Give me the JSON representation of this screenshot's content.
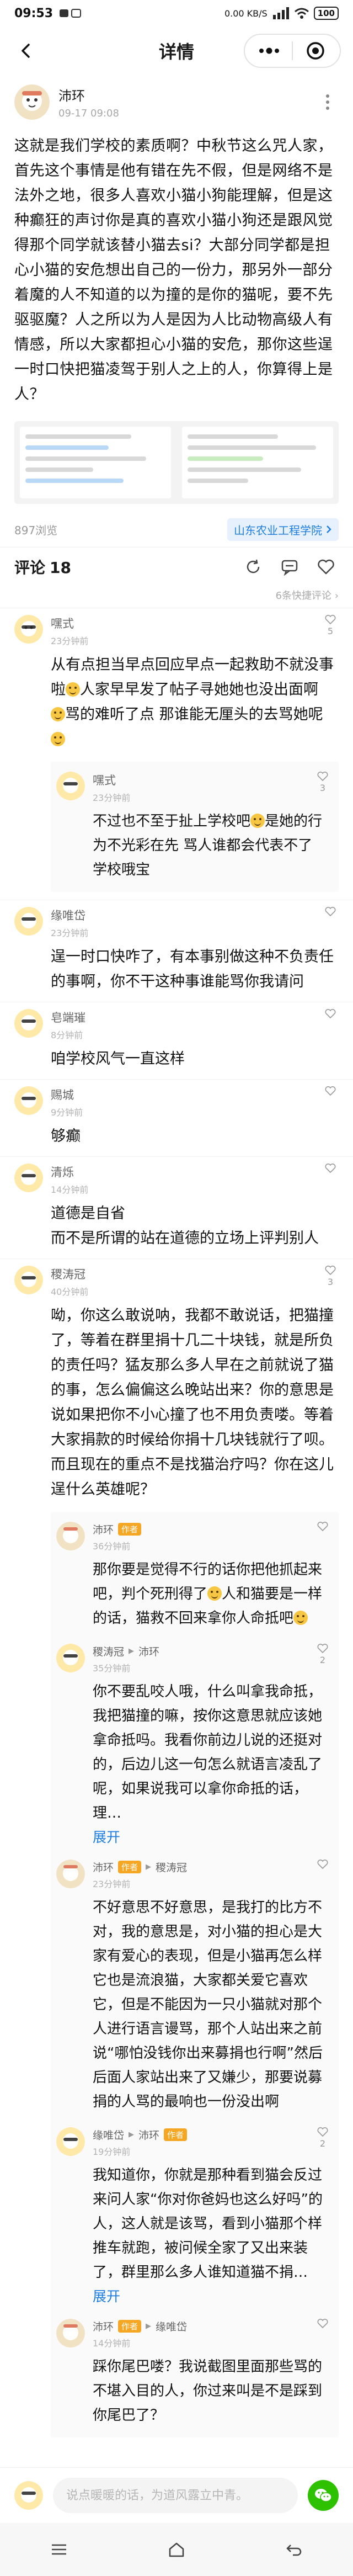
{
  "status": {
    "time": "09:53",
    "indicators": "0.00 KB/S",
    "battery": "100"
  },
  "nav": {
    "title": "详情"
  },
  "post": {
    "author": "沛环",
    "time": "09-17 09:08",
    "body": "这就是我们学校的素质啊？中秋节这么咒人家，首先这个事情是他有错在先不假，但是网络不是法外之地，很多人喜欢小猫小狗能理解，但是这种癫狂的声讨你是真的喜欢小猫小狗还是跟风觉得那个同学就该替小猫去si？大部分同学都是担心小猫的安危想出自己的一份力，那另外一部分着魔的人不知道的以为撞的是你的猫呢，要不先驱驱魔？人之所以为人是因为人比动物高级人有情感，所以大家都担心小猫的安危，那你这些逞一时口快把猫凌驾于别人之上的人，你算得上是人？",
    "views": "897浏览",
    "tag": "山东农业工程学院"
  },
  "comments_header": {
    "title": "评论",
    "count": "18",
    "hidden_note": "6条快捷评论"
  },
  "comments": [
    {
      "name": "嘿式",
      "time": "23分钟前",
      "likes": "5",
      "text_a": "从有点担当早点回应早点一起救助不就没事啦",
      "text_b": "人家早早发了帖子寻她她也没出面啊",
      "text_c": "骂的难听了点 那谁能无厘头的去骂她呢",
      "reply": {
        "name": "嘿式",
        "time": "23分钟前",
        "likes": "3",
        "text": "不过也不至于扯上学校吧",
        "text_b": "是她的行为不光彩在先 骂人谁都会代表不了学校哦宝"
      }
    },
    {
      "name": "缘唯岱",
      "time": "23分钟前",
      "likes": "",
      "text": "逞一时口快咋了，有本事别做这种不负责任的事啊，你不干这种事谁能骂你我请问"
    },
    {
      "name": "皂端璀",
      "time": "8分钟前",
      "likes": "",
      "text": "咱学校风气一直这样"
    },
    {
      "name": "赐城",
      "time": "9分钟前",
      "likes": "",
      "text": "够癫"
    },
    {
      "name": "清烁",
      "time": "14分钟前",
      "likes": "",
      "text": "道德是自省\n而不是所谓的站在道德的立场上评判别人"
    },
    {
      "name": "稷涛冠",
      "time": "40分钟前",
      "likes": "3",
      "text": "呦，你这么敢说呐，我都不敢说话，把猫撞了，等着在群里捐十几二十块钱，就是所负的责任吗？猛友那么多人早在之前就说了猫的事，怎么偏偏这么晚站出来？你的意思是说如果把你不小心撞了也不用负责喽。等着大家捐款的时候给你捐十几块钱就行了呗。而且现在的重点不是找猫治疗吗？你在这儿逞什么英雄呢？",
      "replies": [
        {
          "name": "沛环",
          "badge": "作者",
          "target": "",
          "time": "36分钟前",
          "likes": "",
          "text_a": "那你要是觉得不行的话你把他抓起来吧，判个死刑得了",
          "text_b": "人和猫要是一样的话，猫救不回来拿你人命抵吧",
          "expand": ""
        },
        {
          "name": "稷涛冠",
          "badge": "",
          "target": "沛环",
          "time": "35分钟前",
          "likes": "2",
          "text_a": "你不要乱咬人哦，什么叫拿我命抵，我把猫撞的嘛，按你这意思就应该她拿命抵吗。我看你前边儿说的还挺对的，后边儿这一句怎么就语言凌乱了呢，如果说我可以拿你命抵的话，理…",
          "text_b": "",
          "expand": "展开"
        },
        {
          "name": "沛环",
          "badge": "作者",
          "target": "稷涛冠",
          "time": "23分钟前",
          "likes": "",
          "text_a": "不好意思不好意思，是我打的比方不对，我的意思是，对小猫的担心是大家有爱心的表现，但是小猫再怎么样它也是流浪猫，大家都关爱它喜欢它，但是不能因为一只小猫就对那个人进行语言谩骂，那个人站出来之前说“哪怕没钱你出来募捐也行啊”然后后面人家站出来了又嫌少，那要说募捐的人骂的最响也一份没出啊",
          "text_b": "",
          "expand": ""
        },
        {
          "name": "缘唯岱",
          "badge": "",
          "target": "沛环",
          "time": "19分钟前",
          "likes": "2",
          "text_a": "我知道你，你就是那种看到猫会反过来问人家“你对你爸妈也这么好吗”的人，这人就是该骂，看到小猫那个样推车就跑，被问候全家了又出来装了，群里那么多人谁知道猫不捐…",
          "text_b": "",
          "expand": "展开"
        },
        {
          "name": "沛环",
          "badge": "作者",
          "target": "缘唯岱",
          "time": "14分钟前",
          "likes": "",
          "text_a": "踩你尾巴喽？我说截图里面那些骂的不堪入目的人，你过来叫是不是踩到你尾巴了？",
          "text_b": "",
          "expand": ""
        }
      ]
    }
  ],
  "input_bar": {
    "placeholder": "说点暖暖的话，为道风露立中青。"
  },
  "colors": {
    "accent": "#1e7ee0",
    "author_badge": "#f5a623",
    "wechat": "#2dc100"
  }
}
